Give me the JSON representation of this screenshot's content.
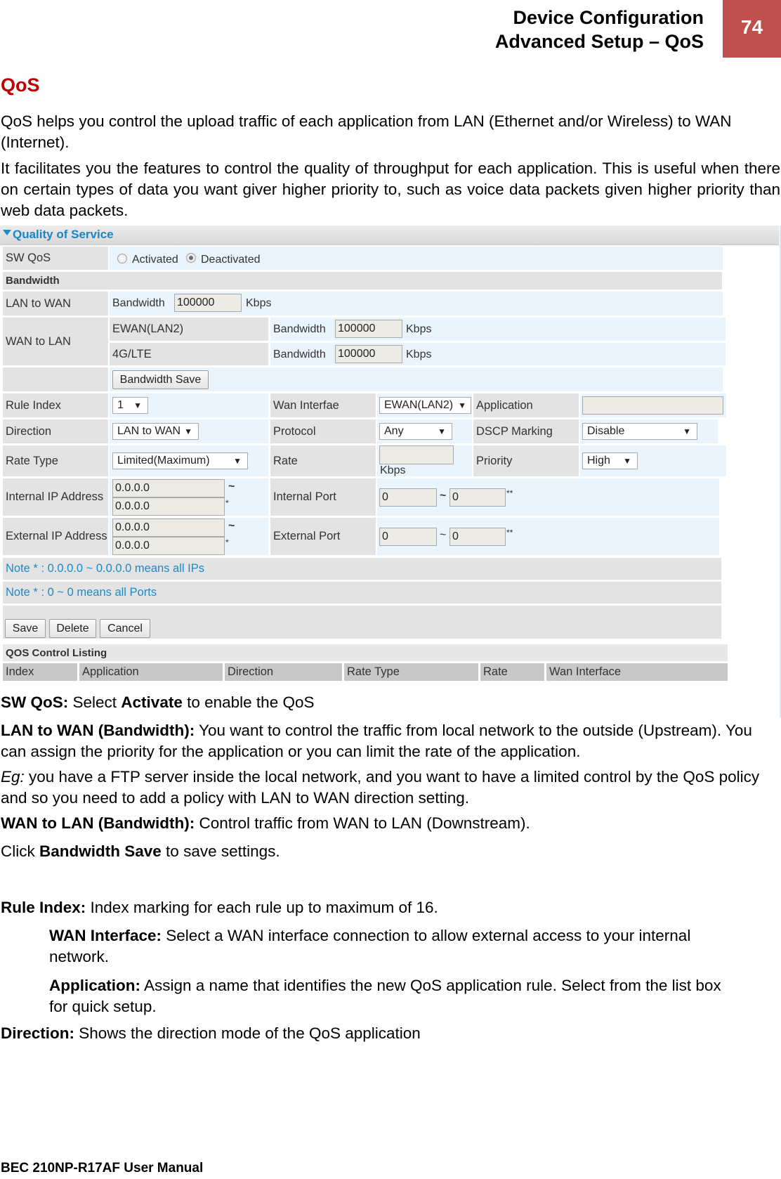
{
  "header": {
    "line1": "Device Configuration",
    "line2": "Advanced Setup – QoS",
    "page_number": "74"
  },
  "section_title": "QoS",
  "intro": {
    "p1": "QoS helps you control the upload traffic of each application from LAN (Ethernet and/or Wireless) to WAN (Internet).",
    "p2": "It facilitates you the features to control the quality of throughput for each application. This is useful when there on certain types of data you want giver higher priority to, such as voice data packets given higher priority than web data packets."
  },
  "panel": {
    "title": "Quality of Service",
    "sw_qos": {
      "label": "SW QoS",
      "options": [
        "Activated",
        "Deactivated"
      ],
      "selected": "Deactivated"
    },
    "bandwidth_heading": "Bandwidth",
    "lan_to_wan": {
      "label": "LAN to WAN",
      "field_label": "Bandwidth",
      "value": "100000",
      "unit": "Kbps"
    },
    "wan_to_lan": {
      "label": "WAN to LAN",
      "rows": [
        {
          "iface": "EWAN(LAN2)",
          "field_label": "Bandwidth",
          "value": "100000",
          "unit": "Kbps"
        },
        {
          "iface": "4G/LTE",
          "field_label": "Bandwidth",
          "value": "100000",
          "unit": "Kbps"
        }
      ]
    },
    "bandwidth_save": "Bandwidth Save",
    "rule_index": {
      "label": "Rule Index",
      "value": "1"
    },
    "wan_interface": {
      "label": "Wan Interfae",
      "value": "EWAN(LAN2)"
    },
    "application": {
      "label": "Application",
      "value": ""
    },
    "direction": {
      "label": "Direction",
      "value": "LAN to WAN"
    },
    "protocol": {
      "label": "Protocol",
      "value": "Any"
    },
    "dscp_marking": {
      "label": "DSCP Marking",
      "value": "Disable"
    },
    "rate_type": {
      "label": "Rate Type",
      "value": "Limited(Maximum)"
    },
    "rate": {
      "label": "Rate",
      "value": "",
      "unit": "Kbps"
    },
    "priority": {
      "label": "Priority",
      "value": "High"
    },
    "internal_ip": {
      "label": "Internal IP Address",
      "start": "0.0.0.0",
      "end": "0.0.0.0",
      "tilde": "~",
      "star": "*"
    },
    "internal_port": {
      "label": "Internal Port",
      "start": "0",
      "end": "0",
      "tilde": "~",
      "stars": "**"
    },
    "external_ip": {
      "label": "External IP Address",
      "start": "0.0.0.0",
      "end": "0.0.0.0",
      "tilde": "~",
      "star": "*"
    },
    "external_port": {
      "label": "External Port",
      "start": "0",
      "end": "0",
      "tilde": "~",
      "stars": "**"
    },
    "note_ip": "Note * : 0.0.0.0 ~ 0.0.0.0 means all IPs",
    "note_port": "Note * : 0 ~ 0 means all Ports",
    "buttons": {
      "save": "Save",
      "delete": "Delete",
      "cancel": "Cancel"
    },
    "listing": {
      "title": "QOS Control Listing",
      "columns": [
        "Index",
        "Application",
        "Direction",
        "Rate Type",
        "Rate",
        "Wan Interface"
      ]
    }
  },
  "descriptions": {
    "sw_qos": {
      "term": "SW QoS:",
      "t1": " Select ",
      "bold": "Activate",
      "t2": " to enable the QoS"
    },
    "lan_to_wan": {
      "term": "LAN to WAN (Bandwidth):",
      "text": " You want to control the traffic from local network to the outside (Upstream). You can assign the priority for the application or you can limit the rate of the application."
    },
    "eg": {
      "term": "Eg:",
      "text": " you have a FTP server inside the local network, and you want to have a limited control by the QoS policy and so you need to add a policy with LAN to WAN direction setting."
    },
    "wan_to_lan": {
      "term": "WAN to LAN (Bandwidth):",
      "text": " Control traffic from WAN to LAN (Downstream)."
    },
    "click": {
      "t1": "Click ",
      "bold": "Bandwidth Save",
      "t2": " to save settings."
    },
    "rule_index": {
      "term": "Rule Index:",
      "text": " Index marking for each rule up to maximum of 16."
    },
    "wan_interface": {
      "term": "WAN Interface:",
      "text": " Select a WAN interface connection to allow external access to your internal network."
    },
    "application": {
      "term": "Application:",
      "text": " Assign a name that identifies the new QoS application rule. Select from the list box for quick setup."
    },
    "direction": {
      "term": "Direction:",
      "text": " Shows the direction mode of the QoS application"
    }
  },
  "footer": "BEC 210NP-R17AF User Manual",
  "colors": {
    "accent_red": "#c00000",
    "badge": "#c0504d",
    "link_blue": "#1a84c4"
  }
}
